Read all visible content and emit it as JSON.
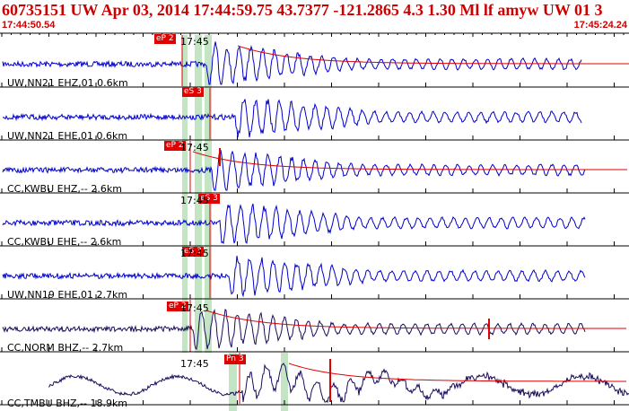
{
  "header": {
    "title": "60735151 UW Apr 03, 2014 17:44:59.75   43.7377 -121.2865  4.3 1.30 Ml lf amyw UW 01   3",
    "start_time": "17:44:50.54",
    "end_time": "17:45:24.24"
  },
  "channels": [
    {
      "label": "UW,NN21 EHZ,01 0.6km",
      "pick": "eP 2",
      "tick": "17:45",
      "trace_color": "#0000cc"
    },
    {
      "label": "UW,NN21 EHE,01 0.6km",
      "pick": "eS 3",
      "tick": "",
      "trace_color": "#0000cc"
    },
    {
      "label": "CC,KWBU EHZ,-- 2.6km",
      "pick": "eP 2",
      "tick": "17:45",
      "trace_color": "#0000cc"
    },
    {
      "label": "CC,KWBU EHE,-- 2.6km",
      "pick": "eS 3",
      "tick": "17:45",
      "trace_color": "#0000cc"
    },
    {
      "label": "UW,NN19 EHE,01 2.7km",
      "pick": "eS 3",
      "tick": "17:45",
      "trace_color": "#0000cc"
    },
    {
      "label": "CC,NORM BHZ,-- 2.7km",
      "pick": "eP 2",
      "tick": "17:45",
      "trace_color": "#1a0a5a"
    },
    {
      "label": "CC,TMBU BHZ,-- 18.9km",
      "pick": "Pn 3",
      "tick": "17:45",
      "trace_color": "#1a0a5a"
    }
  ],
  "colors": {
    "pick_red": "#e00000",
    "blue_trace": "#0000cc",
    "dark_trace": "#1a0a5a",
    "window_green": "#b8e0b8"
  }
}
